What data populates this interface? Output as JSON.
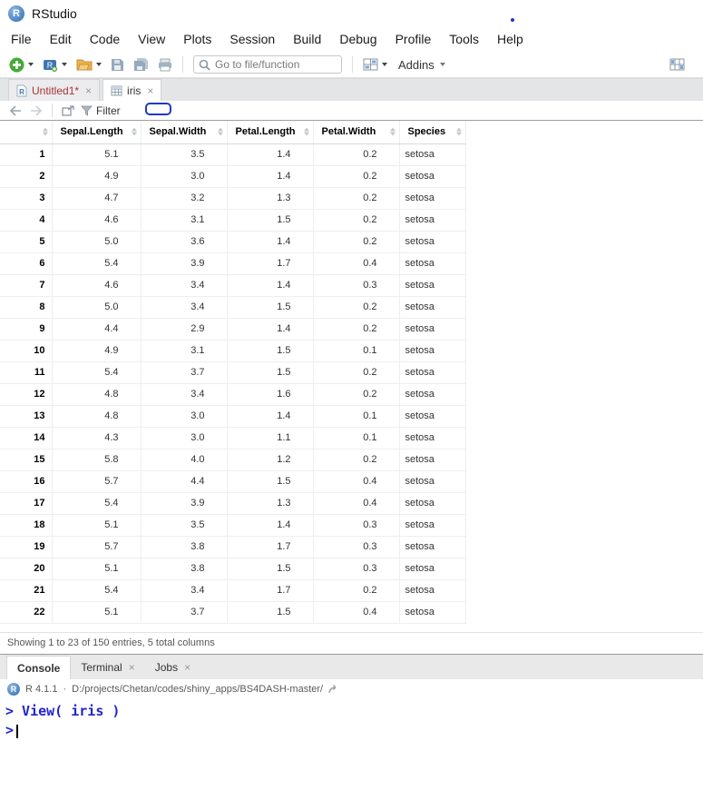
{
  "colors": {
    "console-input": "#2323cd",
    "modified-tab": "#a93434",
    "annotation": "#2038c8"
  },
  "window": {
    "title": "RStudio"
  },
  "menu": {
    "items": [
      "File",
      "Edit",
      "Code",
      "View",
      "Plots",
      "Session",
      "Build",
      "Debug",
      "Profile",
      "Tools",
      "Help"
    ]
  },
  "toolbar": {
    "goto_placeholder": "Go to file/function",
    "addins_label": "Addins"
  },
  "editor_tabs": [
    {
      "label": "Untitled1*",
      "active": false,
      "modified": true
    },
    {
      "label": "iris",
      "active": true,
      "modified": false
    }
  ],
  "viewer": {
    "filter_label": "Filter"
  },
  "table": {
    "columns": [
      "Sepal.Length",
      "Sepal.Width",
      "Petal.Length",
      "Petal.Width",
      "Species"
    ],
    "rows": [
      [
        "1",
        "5.1",
        "3.5",
        "1.4",
        "0.2",
        "setosa"
      ],
      [
        "2",
        "4.9",
        "3.0",
        "1.4",
        "0.2",
        "setosa"
      ],
      [
        "3",
        "4.7",
        "3.2",
        "1.3",
        "0.2",
        "setosa"
      ],
      [
        "4",
        "4.6",
        "3.1",
        "1.5",
        "0.2",
        "setosa"
      ],
      [
        "5",
        "5.0",
        "3.6",
        "1.4",
        "0.2",
        "setosa"
      ],
      [
        "6",
        "5.4",
        "3.9",
        "1.7",
        "0.4",
        "setosa"
      ],
      [
        "7",
        "4.6",
        "3.4",
        "1.4",
        "0.3",
        "setosa"
      ],
      [
        "8",
        "5.0",
        "3.4",
        "1.5",
        "0.2",
        "setosa"
      ],
      [
        "9",
        "4.4",
        "2.9",
        "1.4",
        "0.2",
        "setosa"
      ],
      [
        "10",
        "4.9",
        "3.1",
        "1.5",
        "0.1",
        "setosa"
      ],
      [
        "11",
        "5.4",
        "3.7",
        "1.5",
        "0.2",
        "setosa"
      ],
      [
        "12",
        "4.8",
        "3.4",
        "1.6",
        "0.2",
        "setosa"
      ],
      [
        "13",
        "4.8",
        "3.0",
        "1.4",
        "0.1",
        "setosa"
      ],
      [
        "14",
        "4.3",
        "3.0",
        "1.1",
        "0.1",
        "setosa"
      ],
      [
        "15",
        "5.8",
        "4.0",
        "1.2",
        "0.2",
        "setosa"
      ],
      [
        "16",
        "5.7",
        "4.4",
        "1.5",
        "0.4",
        "setosa"
      ],
      [
        "17",
        "5.4",
        "3.9",
        "1.3",
        "0.4",
        "setosa"
      ],
      [
        "18",
        "5.1",
        "3.5",
        "1.4",
        "0.3",
        "setosa"
      ],
      [
        "19",
        "5.7",
        "3.8",
        "1.7",
        "0.3",
        "setosa"
      ],
      [
        "20",
        "5.1",
        "3.8",
        "1.5",
        "0.3",
        "setosa"
      ],
      [
        "21",
        "5.4",
        "3.4",
        "1.7",
        "0.2",
        "setosa"
      ],
      [
        "22",
        "5.1",
        "3.7",
        "1.5",
        "0.4",
        "setosa"
      ]
    ],
    "status": "Showing 1 to 23 of 150 entries, 5 total columns"
  },
  "console": {
    "tabs": [
      {
        "label": "Console",
        "active": true,
        "closable": false
      },
      {
        "label": "Terminal",
        "active": false,
        "closable": true
      },
      {
        "label": "Jobs",
        "active": false,
        "closable": true
      }
    ],
    "r_version": "R 4.1.1",
    "separator": "·",
    "working_dir": "D:/projects/Chetan/codes/shiny_apps/BS4DASH-master/",
    "command": "> View( iris )",
    "prompt": ">"
  }
}
